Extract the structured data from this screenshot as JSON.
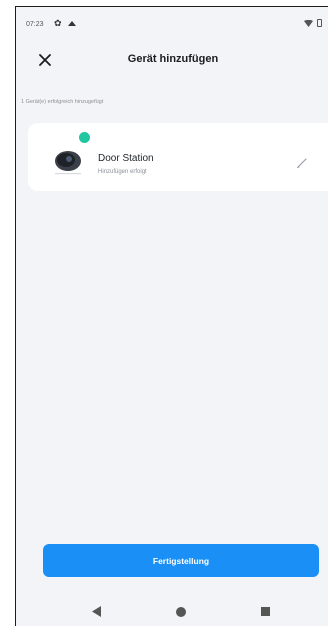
{
  "status_bar": {
    "time": "07:23",
    "icons": [
      "gear-icon",
      "cloud-icon",
      "wifi-icon",
      "battery-icon"
    ]
  },
  "header": {
    "title": "Gerät hinzufügen",
    "close_icon": "close-icon"
  },
  "info": {
    "text": "1 Gerät(e) erfolgreich hinzugefügt"
  },
  "device": {
    "name": "Door Station",
    "status": "Hinzufügen erfolgt",
    "badge": "check-badge-icon",
    "image": "door-station-camera",
    "edit_icon": "pencil-icon"
  },
  "actions": {
    "finish_label": "Fertigstellung"
  },
  "nav": {
    "back_icon": "back-icon",
    "home_icon": "home-icon",
    "recents_icon": "recents-icon"
  },
  "colors": {
    "accent": "#1a8ff6",
    "success": "#21c7a0",
    "background": "#f3f4f7",
    "card": "#ffffff"
  }
}
